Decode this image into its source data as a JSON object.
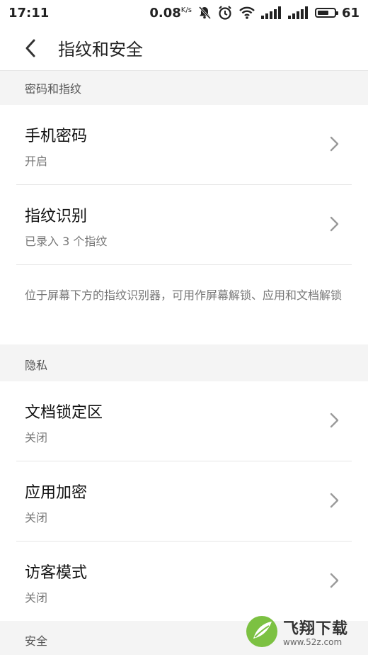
{
  "status_bar": {
    "time": "17:11",
    "speed": "0.08",
    "speed_unit": "K/s",
    "battery_level": "61",
    "icons": [
      "bell-muted-icon",
      "alarm-icon",
      "wifi-icon",
      "signal-icon",
      "signal-icon",
      "battery-icon"
    ]
  },
  "header": {
    "title": "指纹和安全"
  },
  "sections": {
    "password_fingerprint": "密码和指纹",
    "privacy": "隐私",
    "security": "安全"
  },
  "rows": {
    "phone_password": {
      "title": "手机密码",
      "status": "开启"
    },
    "fingerprint": {
      "title": "指纹识别",
      "status": "已录入 3 个指纹"
    },
    "doc_lock": {
      "title": "文档锁定区",
      "status": "关闭"
    },
    "app_encrypt": {
      "title": "应用加密",
      "status": "关闭"
    },
    "guest_mode": {
      "title": "访客模式",
      "status": "关闭"
    }
  },
  "fingerprint_note": "位于屏幕下方的指纹识别器，可用作屏幕解锁、应用和文档解锁",
  "watermark": {
    "brand": "飞翔下载",
    "url": "www.52z.com"
  },
  "colors": {
    "section_bg": "#f4f4f4",
    "divider": "#e6e6e6",
    "chevron": "#9a9a9a",
    "watermark_green": "#7cc142"
  }
}
